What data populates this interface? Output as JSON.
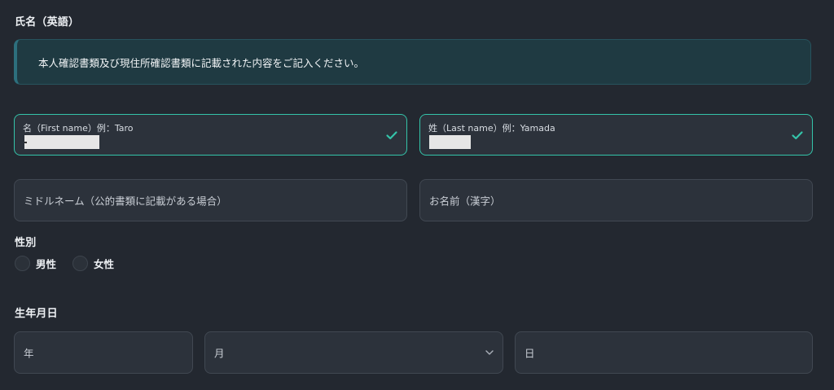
{
  "name_section": {
    "title": "氏名（英語）",
    "notice": "本人確認書類及び現住所確認書類に記載された内容をご記入ください。"
  },
  "first_name": {
    "label": "名（First name）例：Taro",
    "state": "valid"
  },
  "last_name": {
    "label": "姓（Last name）例：Yamada",
    "state": "valid"
  },
  "middle_name": {
    "placeholder": "ミドルネーム（公的書類に記載がある場合）"
  },
  "kanji_name": {
    "placeholder": "お名前（漢字）"
  },
  "gender": {
    "title": "性別",
    "options": [
      {
        "label": "男性",
        "selected": false
      },
      {
        "label": "女性",
        "selected": false
      }
    ]
  },
  "birthdate": {
    "title": "生年月日",
    "year_placeholder": "年",
    "month_placeholder": "月",
    "day_placeholder": "日"
  },
  "colors": {
    "background": "#232830",
    "field_background": "#2c323b",
    "valid_border": "#34c4a9",
    "notice_background": "#1f3a42"
  },
  "icons": {
    "valid": "check-icon",
    "dropdown": "chevron-down-icon"
  }
}
